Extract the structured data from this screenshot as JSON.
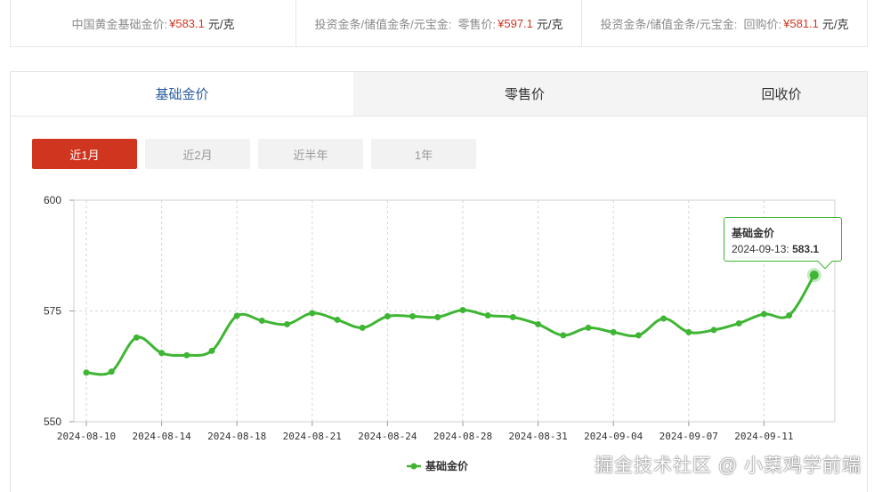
{
  "top_prices": [
    {
      "label": "中国黄金基础金价:",
      "value": "¥583.1",
      "unit": "元/克"
    },
    {
      "label": "投资金条/储值金条/元宝金:  零售价:",
      "value": "¥597.1",
      "unit": "元/克"
    },
    {
      "label": "投资金条/储值金条/元宝金:  回购价:",
      "value": "¥581.1",
      "unit": "元/克"
    }
  ],
  "tabs": [
    "基础金价",
    "零售价",
    "回收价"
  ],
  "active_tab": 0,
  "ranges": [
    "近1月",
    "近2月",
    "近半年",
    "1年"
  ],
  "active_range": 0,
  "tooltip": {
    "title": "基础金价",
    "date": "2024-09-13:",
    "value": "583.1"
  },
  "watermark": "掘金技术社区 @ 小菜鸡学前端",
  "colors": {
    "accent": "#d0351f",
    "line": "#3fb534",
    "tab_active_text": "#2a5f9e"
  },
  "chart_data": {
    "type": "line",
    "ylim": [
      550,
      600
    ],
    "yticks": [
      "600",
      "575",
      "550"
    ],
    "xticks": [
      "2024-08-10",
      "2024-08-14",
      "2024-08-18",
      "2024-08-21",
      "2024-08-24",
      "2024-08-28",
      "2024-08-31",
      "2024-09-04",
      "2024-09-07",
      "2024-09-11"
    ],
    "grid": true,
    "legend_position": "bottom",
    "series": [
      {
        "name": "基础金价",
        "values": [
          561.1,
          561.3,
          569.0,
          565.5,
          565.0,
          566.0,
          573.9,
          572.8,
          572.0,
          574.5,
          573.0,
          571.2,
          573.8,
          573.8,
          573.6,
          575.2,
          574.0,
          573.6,
          572.0,
          569.5,
          571.2,
          570.2,
          569.5,
          573.3,
          570.2,
          570.7,
          572.2,
          574.3,
          574.0,
          583.1
        ]
      }
    ]
  }
}
